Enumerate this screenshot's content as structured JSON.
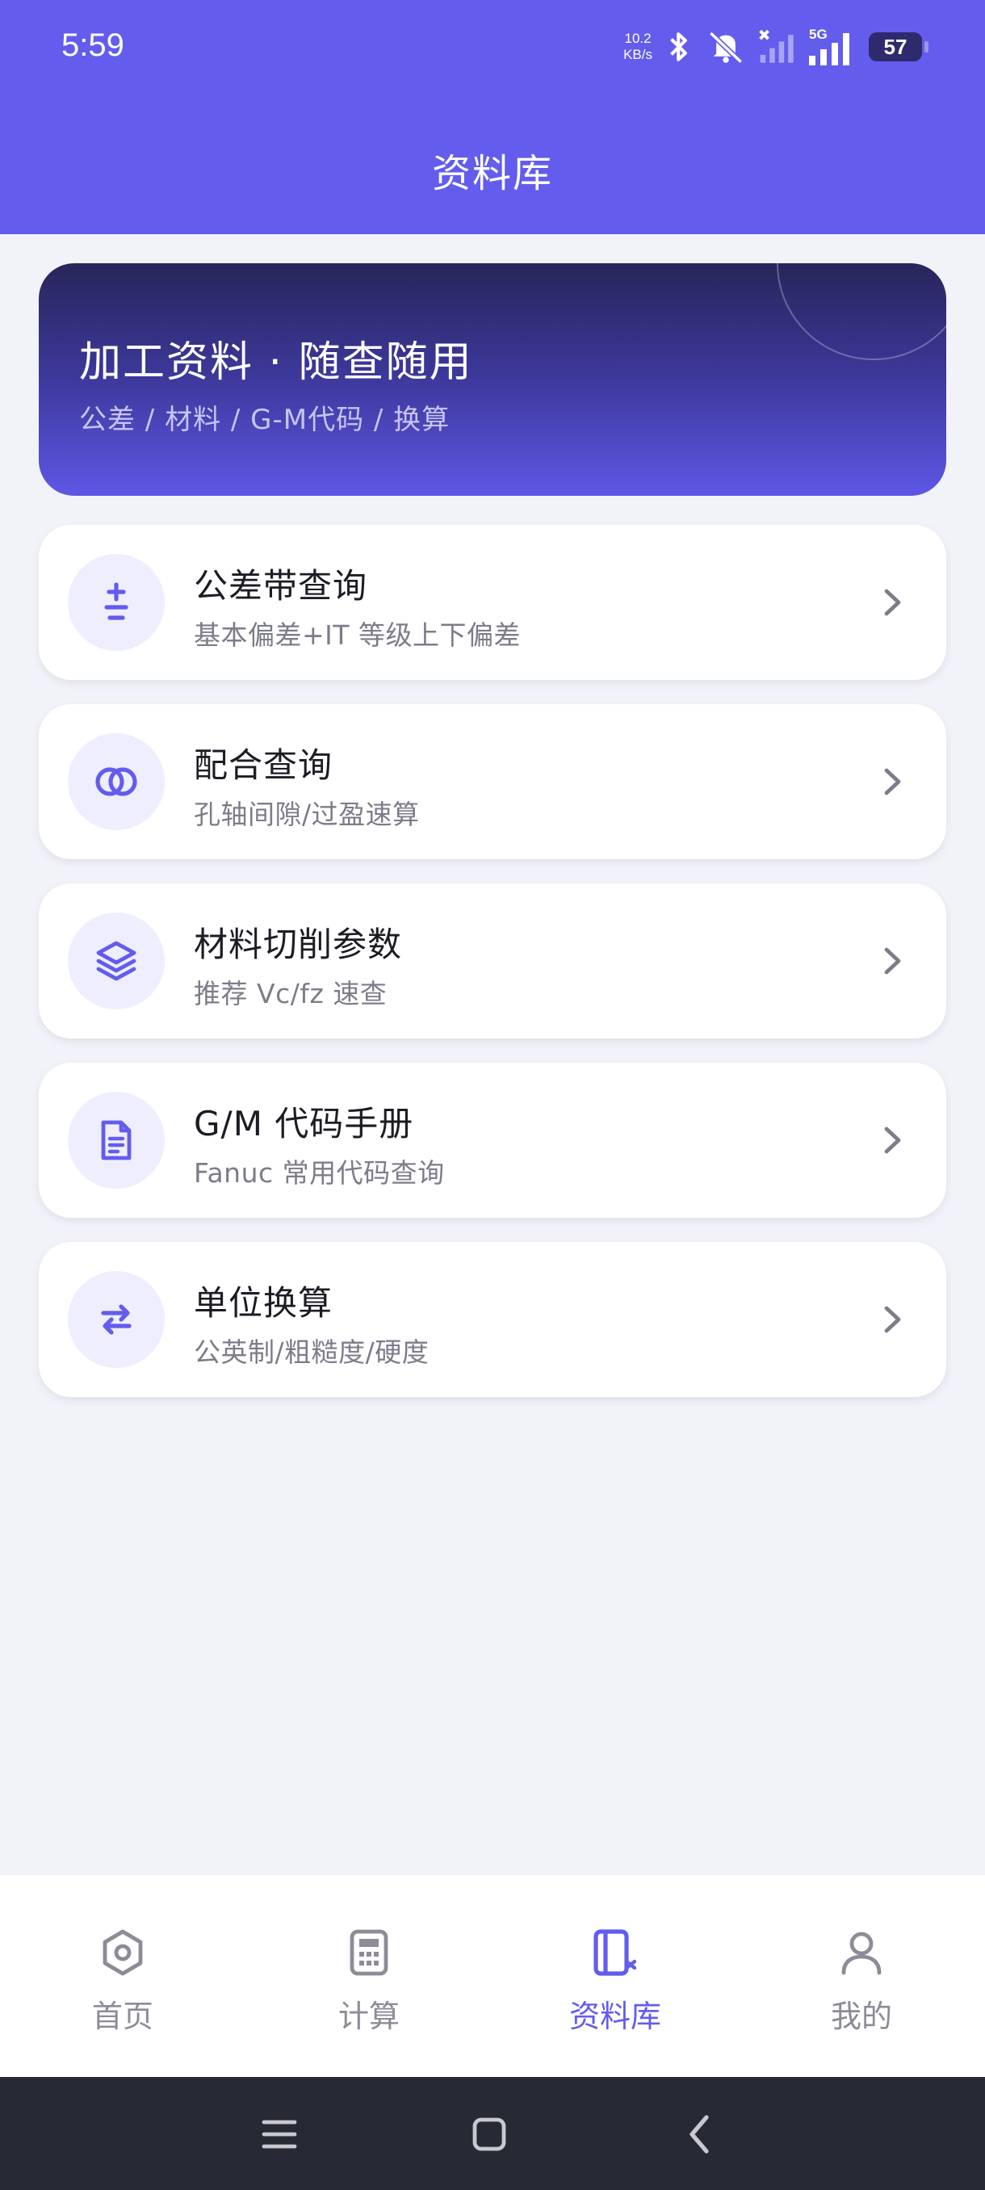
{
  "status_bar": {
    "time": "5:59",
    "net_speed_value": "10.2",
    "net_speed_unit": "KB/s",
    "network_label": "5G",
    "battery": "57"
  },
  "header": {
    "title": "资料库"
  },
  "banner": {
    "title": "加工资料 · 随查随用",
    "subtitle": "公差 / 材料 / G-M代码 / 换算"
  },
  "cards": [
    {
      "title": "公差带查询",
      "subtitle": "基本偏差+IT 等级上下偏差",
      "icon": "plus-minus-icon"
    },
    {
      "title": "配合查询",
      "subtitle": "孔轴间隙/过盈速算",
      "icon": "interlocking-circles-icon"
    },
    {
      "title": "材料切削参数",
      "subtitle": "推荐 Vc/fz 速查",
      "icon": "layers-icon"
    },
    {
      "title": "G/M 代码手册",
      "subtitle": "Fanuc 常用代码查询",
      "icon": "document-icon"
    },
    {
      "title": "单位换算",
      "subtitle": "公英制/粗糙度/硬度",
      "icon": "swap-arrows-icon"
    }
  ],
  "bottom_nav": [
    {
      "label": "首页",
      "icon": "home-hexagon-icon",
      "active": false
    },
    {
      "label": "计算",
      "icon": "calculator-icon",
      "active": false
    },
    {
      "label": "资料库",
      "icon": "library-book-icon",
      "active": true
    },
    {
      "label": "我的",
      "icon": "user-icon",
      "active": false
    }
  ],
  "colors": {
    "accent": "#635ced",
    "background": "#f2f3f9",
    "icon_bg": "#efeefe",
    "inactive_nav": "#8c8c98"
  }
}
